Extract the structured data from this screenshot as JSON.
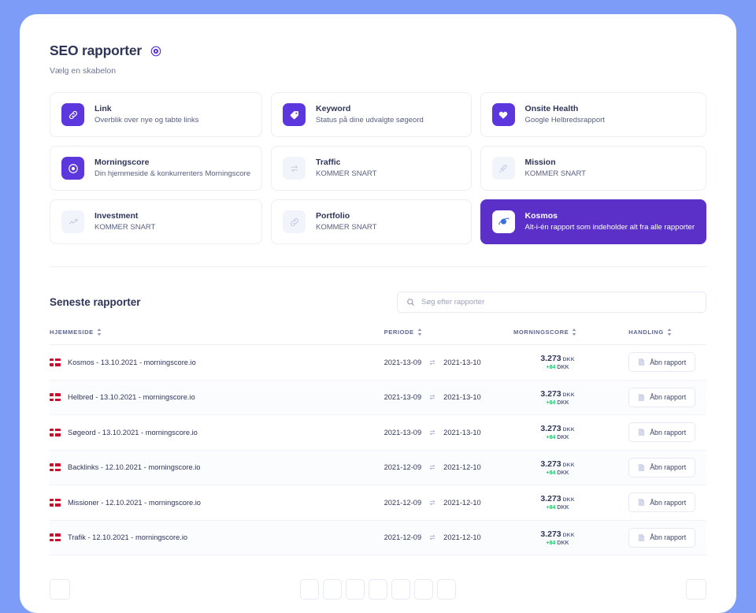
{
  "header": {
    "title": "SEO rapporter",
    "play_icon": "play-circle-icon",
    "subtitle": "Vælg en skabelon"
  },
  "templates": [
    {
      "name": "Link",
      "desc": "Overblik over nye og tabte links",
      "icon": "link-icon",
      "state": "active"
    },
    {
      "name": "Keyword",
      "desc": "Status på dine udvalgte søgeord",
      "icon": "tag-icon",
      "state": "active"
    },
    {
      "name": "Onsite Health",
      "desc": "Google Helbredsrapport",
      "icon": "heart-icon",
      "state": "active"
    },
    {
      "name": "Morningscore",
      "desc": "Din hjemmeside & konkurrenters Morningscore",
      "icon": "target-icon",
      "state": "active"
    },
    {
      "name": "Traffic",
      "desc": "KOMMER SNART",
      "icon": "exchange-icon",
      "state": "disabled"
    },
    {
      "name": "Mission",
      "desc": "KOMMER SNART",
      "icon": "rocket-icon",
      "state": "disabled"
    },
    {
      "name": "Investment",
      "desc": "KOMMER SNART",
      "icon": "trend-up-icon",
      "state": "disabled"
    },
    {
      "name": "Portfolio",
      "desc": "KOMMER SNART",
      "icon": "link-icon",
      "state": "disabled"
    },
    {
      "name": "Kosmos",
      "desc": "Alt-i-én rapport som indeholder alt fra alle rapporter",
      "icon": "planet-icon",
      "state": "selected"
    }
  ],
  "recent": {
    "title": "Seneste rapporter",
    "search": {
      "icon": "search-icon",
      "placeholder": "Søg efter rapporter",
      "value": ""
    },
    "columns": [
      {
        "label": "HJEMMESIDE",
        "sortable": true
      },
      {
        "label": "PERIODE",
        "sortable": true
      },
      {
        "label": "MORNINGSCORE",
        "sortable": true
      },
      {
        "label": "HANDLING",
        "sortable": true
      }
    ],
    "rows": [
      {
        "flag": "denmark-flag",
        "site": "Kosmos - 13.10.2021 - morningscore.io",
        "period_from": "2021-13-09",
        "period_to": "2021-13-10",
        "score": "3.273",
        "currency": "DKK",
        "delta": "+84",
        "delta_currency": "DKK",
        "action": "Åbn rapport"
      },
      {
        "flag": "denmark-flag",
        "site": "Helbred - 13.10.2021 - morningscore.io",
        "period_from": "2021-13-09",
        "period_to": "2021-13-10",
        "score": "3.273",
        "currency": "DKK",
        "delta": "+84",
        "delta_currency": "DKK",
        "action": "Åbn rapport"
      },
      {
        "flag": "denmark-flag",
        "site": "Søgeord - 13.10.2021 - morningscore.io",
        "period_from": "2021-13-09",
        "period_to": "2021-13-10",
        "score": "3.273",
        "currency": "DKK",
        "delta": "+84",
        "delta_currency": "DKK",
        "action": "Åbn rapport"
      },
      {
        "flag": "denmark-flag",
        "site": "Backlinks - 12.10.2021 - morningscore.io",
        "period_from": "2021-12-09",
        "period_to": "2021-12-10",
        "score": "3.273",
        "currency": "DKK",
        "delta": "+84",
        "delta_currency": "DKK",
        "action": "Åbn rapport"
      },
      {
        "flag": "denmark-flag",
        "site": "Missioner - 12.10.2021 - morningscore.io",
        "period_from": "2021-12-09",
        "period_to": "2021-12-10",
        "score": "3.273",
        "currency": "DKK",
        "delta": "+84",
        "delta_currency": "DKK",
        "action": "Åbn rapport"
      },
      {
        "flag": "denmark-flag",
        "site": "Trafik - 12.10.2021 - morningscore.io",
        "period_from": "2021-12-09",
        "period_to": "2021-12-10",
        "score": "3.273",
        "currency": "DKK",
        "delta": "+84",
        "delta_currency": "DKK",
        "action": "Åbn rapport"
      }
    ]
  },
  "pagination": {
    "prev": "",
    "next": "",
    "pages": [
      "",
      "",
      "",
      "",
      "",
      "",
      ""
    ]
  },
  "colors": {
    "page_background": "#7d9cf7",
    "panel": "#ffffff",
    "accent_purple": "#5c37dd",
    "selected_card": "#5a30c8",
    "text_dark": "#2f3558",
    "text_muted": "#5c6690",
    "positive_green": "#28c76f",
    "flag_red": "#c8102e"
  }
}
